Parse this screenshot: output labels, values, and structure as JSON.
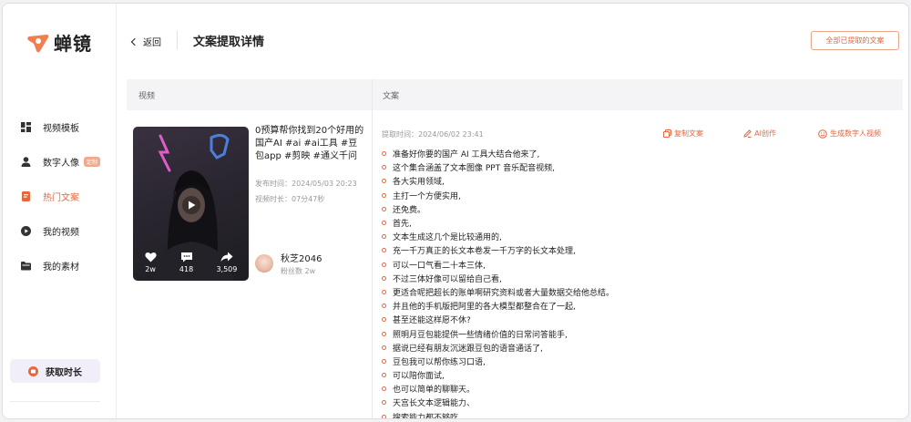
{
  "app": {
    "name": "蝉镜",
    "brand_color": "#e8663d"
  },
  "sidebar": {
    "items": [
      {
        "label": "视频模板",
        "icon": "grid-icon"
      },
      {
        "label": "数字人像",
        "icon": "user-icon",
        "badge": "定制"
      },
      {
        "label": "热门文案",
        "icon": "document-icon",
        "active": true
      },
      {
        "label": "我的视频",
        "icon": "play-circle-icon"
      },
      {
        "label": "我的素材",
        "icon": "folder-icon"
      }
    ],
    "get_time_label": "获取时长"
  },
  "header": {
    "back_label": "返回",
    "title": "文案提取详情",
    "all_extracted_label": "全部已提取的文案"
  },
  "table": {
    "col_video": "视频",
    "col_text": "文案"
  },
  "video": {
    "title": "0预算帮你找到20个好用的国产AI #ai #ai工具 #豆包app #剪映 #通义千问",
    "publish_time": "发布时间：2024/05/03 20:23",
    "duration": "视频时长：07分47秒",
    "likes": "2w",
    "comments": "418",
    "shares": "3,509",
    "author_name": "秋芝2046",
    "author_fans": "粉丝数 2w"
  },
  "transcript": {
    "extract_time": "提取时间：2024/06/02 23:41",
    "copy_label": "复制文案",
    "ai_label": "AI创作",
    "generate_label": "生成数字人视频",
    "lines": [
      "准备好你要的国产 AI 工具大结合他来了,",
      "这个集合涵盖了文本图像 PPT 音乐配音视频,",
      "各大实用领域,",
      "主打一个方便实用,",
      "还免费。",
      "首先,",
      "文本生成这几个是比较通用的,",
      "充一千万真正的长文本卷发一千万字的长文本处理,",
      "可以一口气看二十本三体,",
      "不过三体好像可以留给自己看,",
      "更适合呢把超长的账单啊研究资料或者大量数据交给他总结。",
      "并且他的手机版把阿里的各大模型都整合在了一起,",
      "甚至还能这样愿不休?",
      "照明月豆包能提供一些情绪价值的日常问答能手,",
      "据说已经有朋友沉迷跟豆包的语音通话了,",
      "豆包我可以帮你练习口语,",
      "可以陪你面试,",
      "也可以简单的聊聊天。",
      "天宫长文本逻辑能力、",
      "搜索能力都不够吃,"
    ]
  }
}
